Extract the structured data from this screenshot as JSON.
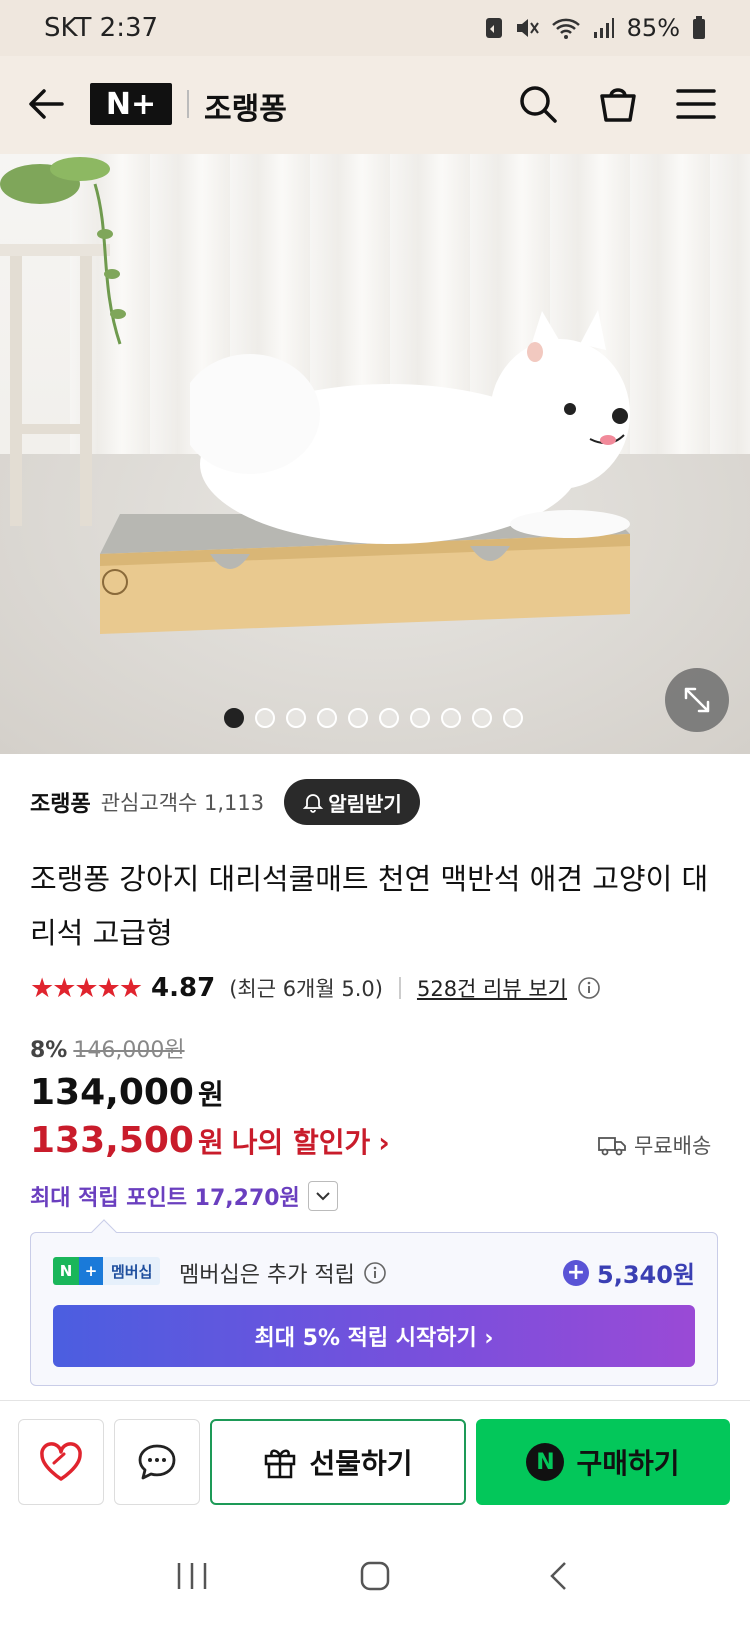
{
  "status": {
    "carrier_time": "SKT 2:37",
    "battery": "85%"
  },
  "header": {
    "logo": "N+",
    "store_name": "조랭퐁"
  },
  "gallery": {
    "dot_count": 10,
    "active_index": 0
  },
  "store": {
    "name": "조랭퐁",
    "fans_label": "관심고객수 1,113",
    "alarm_label": "알림받기"
  },
  "product": {
    "title": "조랭퐁 강아지 대리석쿨매트 천연 맥반석 애견 고양이 대리석 고급형",
    "stars": "★★★★★",
    "rating": "4.87",
    "recent_rating": "(최근 6개월 5.0)",
    "review_link": "528건 리뷰 보기",
    "discount_rate": "8%",
    "original_price": "146,000원",
    "price": "134,000",
    "price_unit": "원",
    "my_price": "133,500",
    "my_price_unit": "원",
    "my_price_label": "나의 할인가",
    "my_price_chevron": "›",
    "shipping": "무료배송",
    "points": "최대 적립 포인트 17,270원"
  },
  "membership": {
    "badge_n": "N",
    "badge_plus": "+",
    "badge_label": "멤버십",
    "text": "멤버십은 추가 적립",
    "points_plus": "+",
    "points": "5,340원",
    "button": "최대 5% 적립 시작하기 ›"
  },
  "actions": {
    "gift": "선물하기",
    "buy": "구매하기",
    "npay": "N"
  },
  "colors": {
    "header_bg": "#f3ece4",
    "price_red": "#c91c2b",
    "points_purple": "#6a3fbf",
    "buy_green": "#03c75a",
    "star_red": "#e0242e"
  }
}
